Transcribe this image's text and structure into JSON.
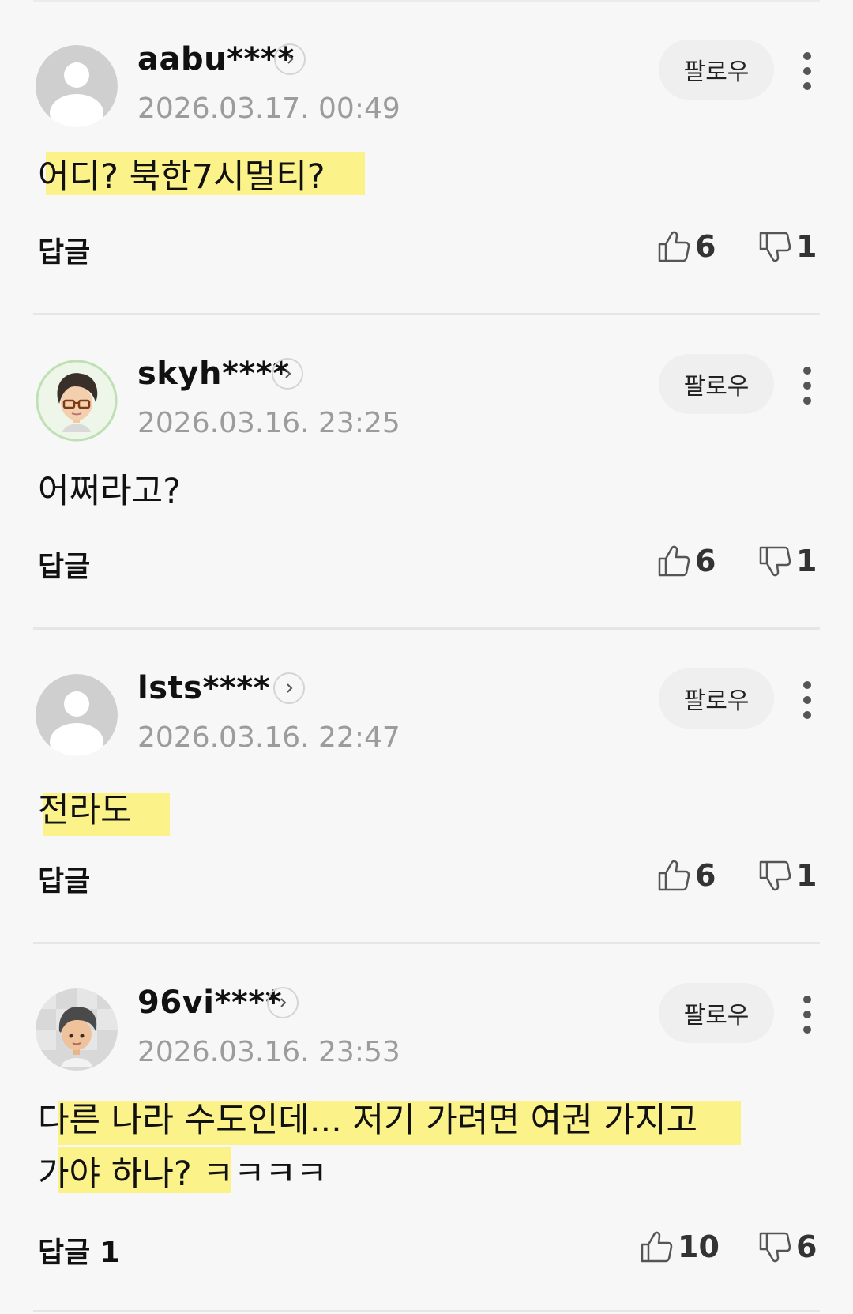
{
  "comments": [
    {
      "user": "aabu****",
      "timestamp": "2026.03.17. 00:49",
      "follow_label": "팔로우",
      "text_lines": [
        "어디? 북한7시멀티?"
      ],
      "reply_label": "답글",
      "likes": "6",
      "dislikes": "1",
      "avatar": "default-avatar"
    },
    {
      "user": "skyh****",
      "timestamp": "2026.03.16. 23:25",
      "follow_label": "팔로우",
      "text_lines": [
        "어쩌라고?"
      ],
      "reply_label": "답글",
      "likes": "6",
      "dislikes": "1",
      "avatar": "character-avatar-glasses"
    },
    {
      "user": "lsts****",
      "timestamp": "2026.03.16. 22:47",
      "follow_label": "팔로우",
      "text_lines": [
        "전라도"
      ],
      "reply_label": "답글",
      "likes": "6",
      "dislikes": "1",
      "avatar": "default-avatar"
    },
    {
      "user": "96vi****",
      "timestamp": "2026.03.16. 23:53",
      "follow_label": "팔로우",
      "text_lines": [
        "다른 나라 수도인데... 저기 가려면 여권 가지고",
        "가야 하나? ㅋㅋㅋㅋ"
      ],
      "reply_label": "답글 1",
      "likes": "10",
      "dislikes": "6",
      "avatar": "character-avatar-boy"
    }
  ],
  "colors": {
    "highlight": "#fbf38a",
    "background": "#f7f7f7",
    "timestamp": "#9c9c9c",
    "follow_button": "#efefef"
  }
}
